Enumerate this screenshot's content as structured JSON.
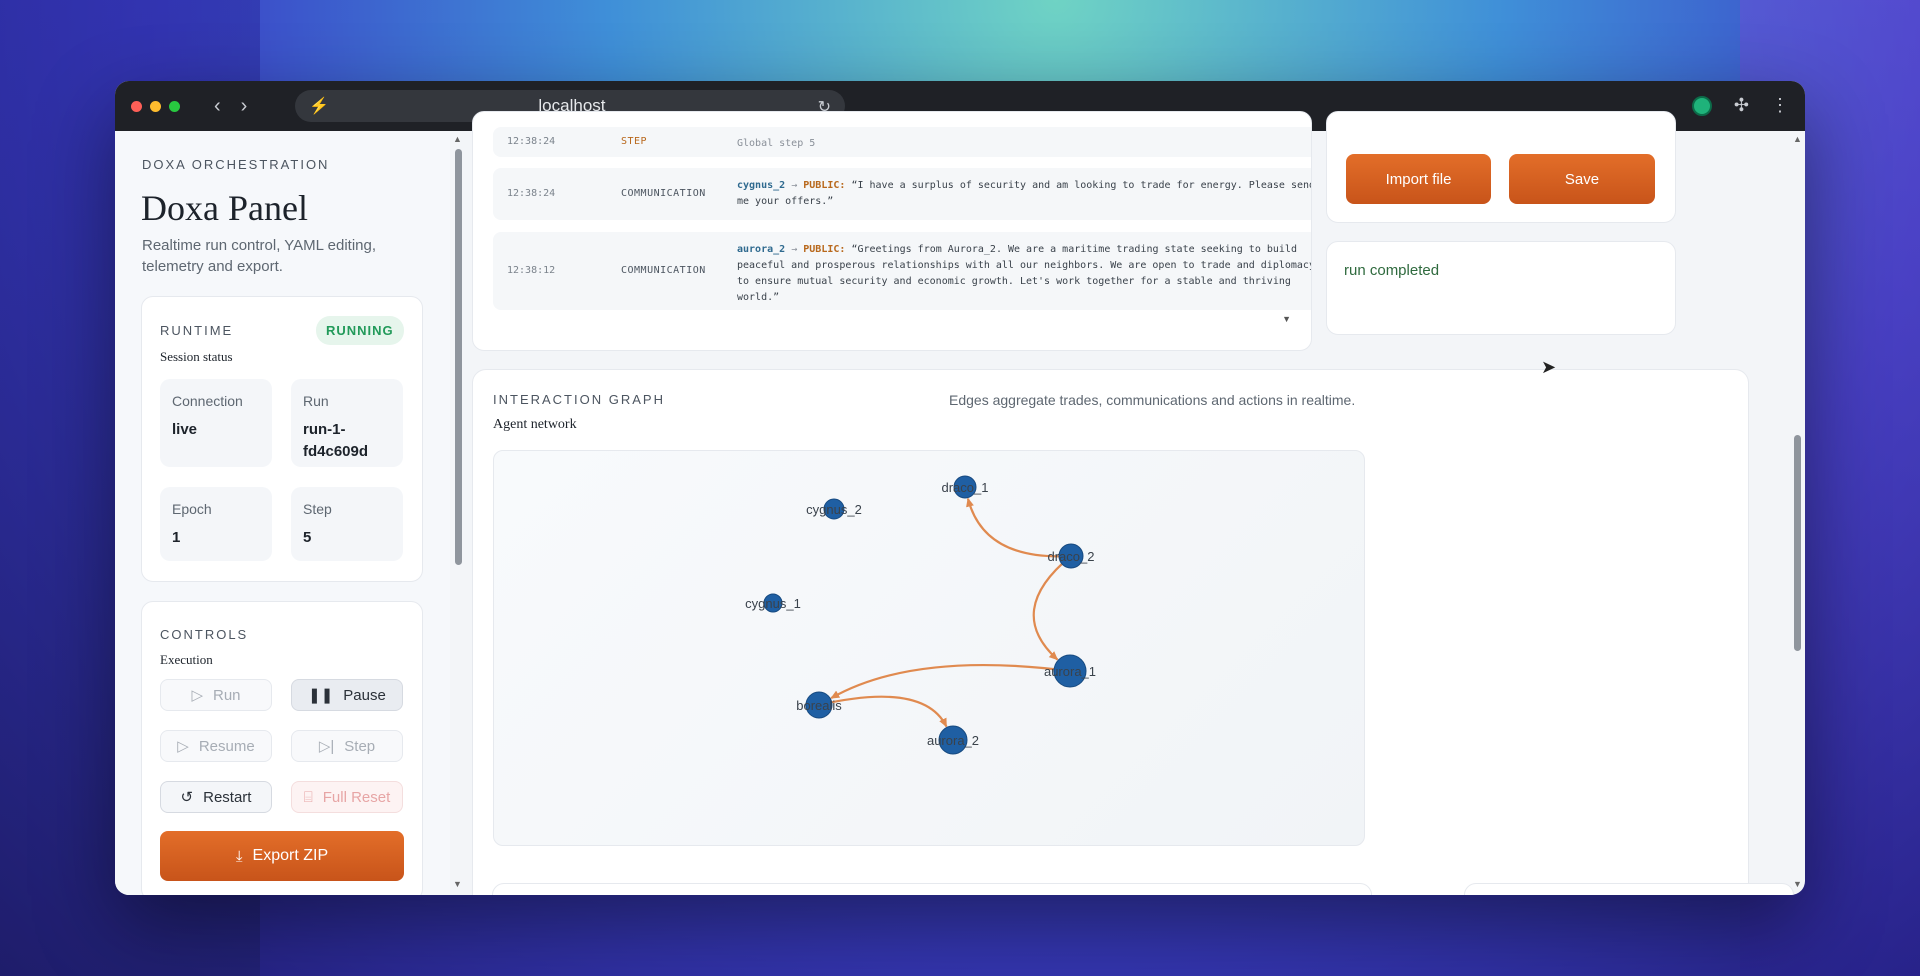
{
  "browser": {
    "url": "localhost"
  },
  "sidebar": {
    "eyebrow": "DOXA ORCHESTRATION",
    "title": "Doxa Panel",
    "description": "Realtime run control, YAML editing, telemetry and export.",
    "runtime": {
      "eyebrow": "RUNTIME",
      "subtitle": "Session status",
      "status_badge": "RUNNING",
      "stats": [
        {
          "label": "Connection",
          "value": "live"
        },
        {
          "label": "Run",
          "value": "run-1-fd4c609d"
        },
        {
          "label": "Epoch",
          "value": "1"
        },
        {
          "label": "Step",
          "value": "5"
        }
      ]
    },
    "controls": {
      "eyebrow": "CONTROLS",
      "subtitle": "Execution",
      "run": "Run",
      "pause": "Pause",
      "resume": "Resume",
      "step": "Step",
      "restart": "Restart",
      "full_reset": "Full Reset",
      "export": "Export ZIP"
    }
  },
  "log": {
    "rows": [
      {
        "time": "12:38:24",
        "type": "STEP",
        "message": "Global step 5"
      },
      {
        "time": "12:38:24",
        "type": "COMMUNICATION",
        "agent": "cygnus_2",
        "scope": "PUBLIC:",
        "text": "“I have a surplus of security and am looking to trade for energy. Please send me your offers.”"
      },
      {
        "time": "12:38:12",
        "type": "COMMUNICATION",
        "agent": "aurora_2",
        "scope": "PUBLIC:",
        "text": "“Greetings from Aurora_2. We are a maritime trading state seeking to build peaceful and prosperous relationships with all our neighbors. We are open to trade and diplomacy to ensure mutual security and economic growth. Let's work together for a stable and thriving world.”"
      }
    ]
  },
  "file_actions": {
    "import": "Import file",
    "save": "Save"
  },
  "status_message": "run completed",
  "graph": {
    "eyebrow": "INTERACTION GRAPH",
    "subtitle": "Agent network",
    "description": "Edges aggregate trades, communications and actions in realtime.",
    "nodes": [
      {
        "id": "draco_1",
        "label": "draco_1"
      },
      {
        "id": "cygnus_2",
        "label": "cygnus_2"
      },
      {
        "id": "draco_2",
        "label": "draco_2"
      },
      {
        "id": "cygnus_1",
        "label": "cygnus_1"
      },
      {
        "id": "aurora_1",
        "label": "aurora_1"
      },
      {
        "id": "borealis",
        "label": "borealis"
      },
      {
        "id": "aurora_2",
        "label": "aurora_2"
      }
    ],
    "edges": [
      {
        "from": "draco_2",
        "to": "draco_1"
      },
      {
        "from": "draco_2",
        "to": "aurora_1"
      },
      {
        "from": "aurora_1",
        "to": "borealis"
      },
      {
        "from": "borealis",
        "to": "aurora_2"
      }
    ],
    "colors": {
      "node": "#1f5fa3",
      "edge": "#e08a4f"
    }
  }
}
